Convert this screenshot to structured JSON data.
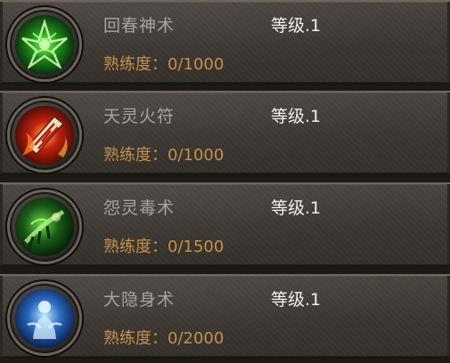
{
  "skills": [
    {
      "name": "回春神术",
      "level": "等级.1",
      "proficiency": "熟练度：0/1000",
      "icon": "green-healing-rune-icon"
    },
    {
      "name": "天灵火符",
      "level": "等级.1",
      "proficiency": "熟练度：0/1000",
      "icon": "fire-talisman-icon"
    },
    {
      "name": "怨灵毒术",
      "level": "等级.1",
      "proficiency": "熟练度：0/1500",
      "icon": "poison-claw-icon"
    },
    {
      "name": "大隐身术",
      "level": "等级.1",
      "proficiency": "熟练度：0/2000",
      "icon": "blue-stealth-figure-icon"
    }
  ],
  "colors": {
    "name_text": "#a8a39d",
    "level_text": "#f2efe8",
    "proficiency_text": "#c4904a",
    "panel_bg": "#3b3631"
  }
}
